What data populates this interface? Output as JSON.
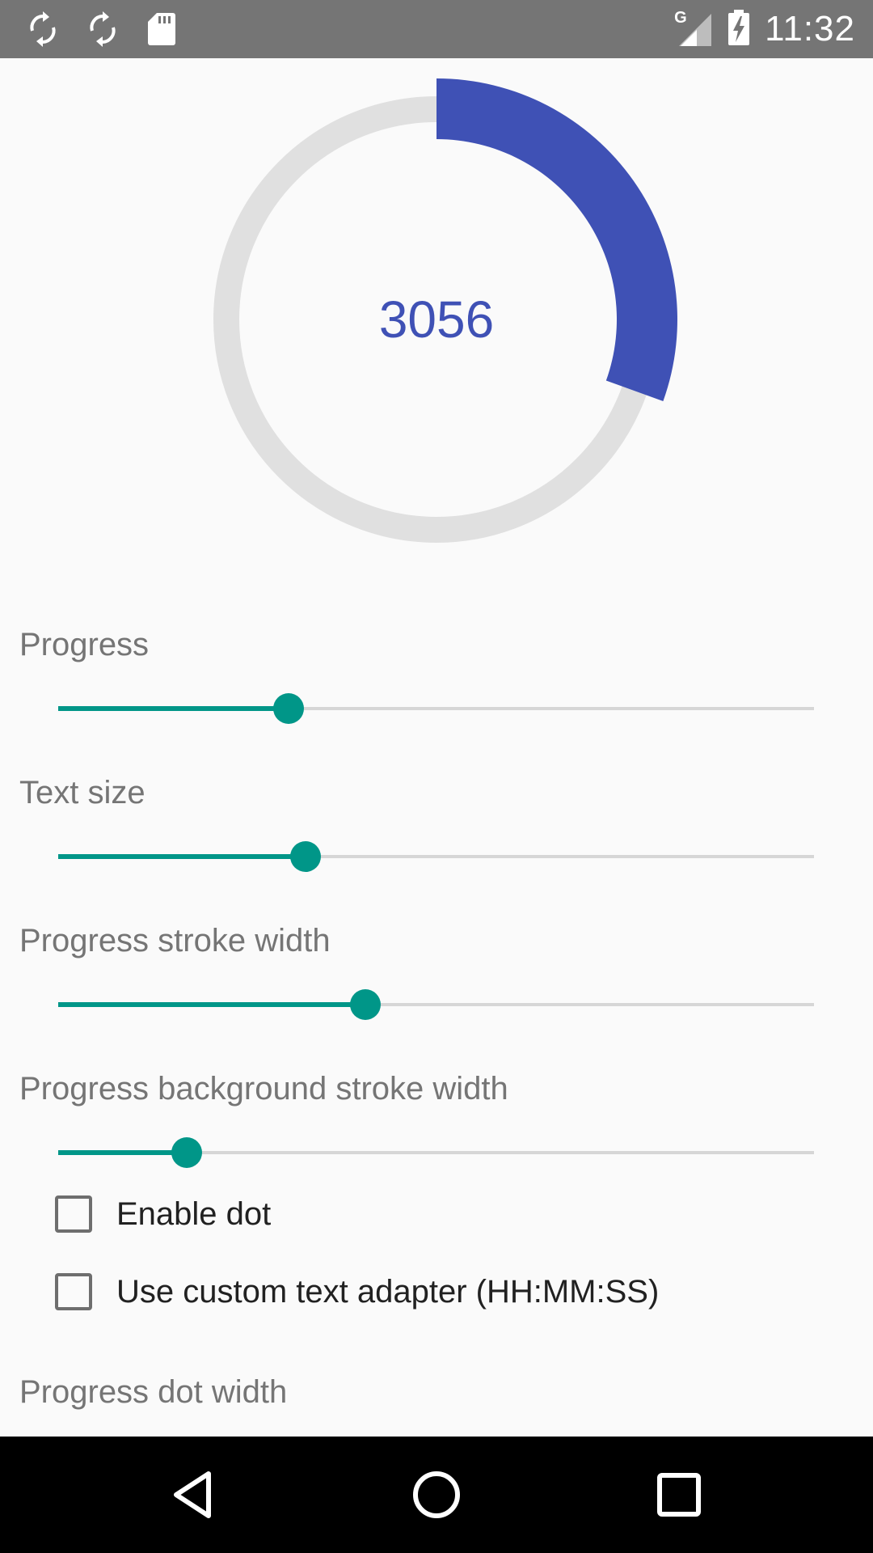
{
  "status_bar": {
    "time": "11:32",
    "network_label": "G",
    "icons": [
      "sync-icon",
      "sync-icon",
      "sd-card-icon",
      "signal-icon",
      "battery-charging-icon"
    ]
  },
  "gauge": {
    "value_text": "3056",
    "progress_fraction": 0.305,
    "colors": {
      "progress": "#3f51b5",
      "background": "#e0e0e0",
      "text": "#3f51b5"
    }
  },
  "settings": {
    "progress": {
      "label": "Progress",
      "value": 0.305
    },
    "text_size": {
      "label": "Text size",
      "value": 0.327
    },
    "progress_stroke_width": {
      "label": "Progress stroke width",
      "value": 0.406
    },
    "progress_background_stroke_width": {
      "label": "Progress background stroke width",
      "value": 0.17
    },
    "enable_dot": {
      "label": "Enable dot",
      "checked": false
    },
    "custom_text_adapter": {
      "label": "Use custom text adapter (HH:MM:SS)",
      "checked": false
    },
    "progress_dot_width": {
      "label": "Progress dot width"
    }
  },
  "nav_bar": {
    "buttons": [
      "back-icon",
      "home-icon",
      "recents-icon"
    ]
  },
  "accent_color": "#009688"
}
